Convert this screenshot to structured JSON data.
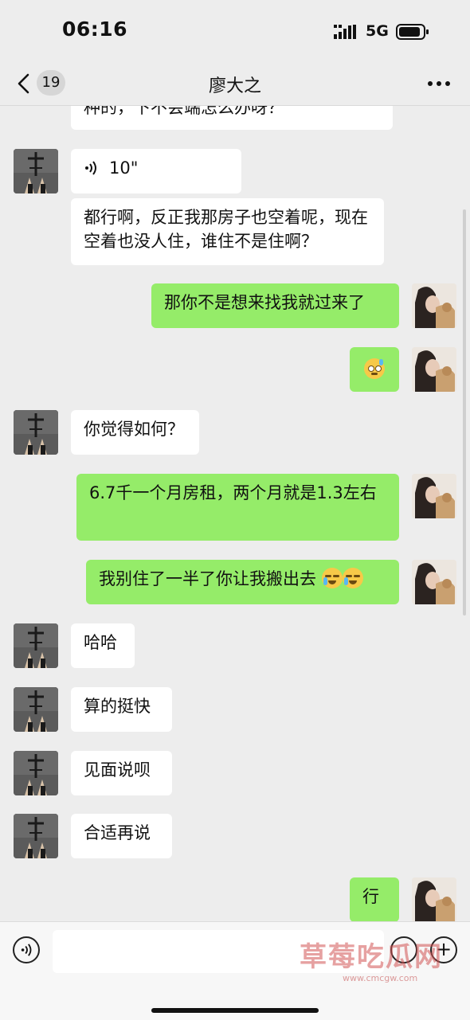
{
  "status_bar": {
    "time": "06:16",
    "network": "5G"
  },
  "header": {
    "back_count": "19",
    "title": "廖大之"
  },
  "messages": [
    {
      "side": "in",
      "type": "text",
      "text": "种的，下不会端怎么办呀？"
    },
    {
      "side": "in",
      "type": "voice",
      "text": "10\""
    },
    {
      "side": "in",
      "type": "text",
      "text": "都行啊，反正我那房子也空着呢，现在空着也没人住，谁住不是住啊？"
    },
    {
      "side": "out",
      "type": "text",
      "text": "那你不是想来找我就过来了"
    },
    {
      "side": "out",
      "type": "emoji",
      "text": ""
    },
    {
      "side": "in",
      "type": "text",
      "text": "你觉得如何？"
    },
    {
      "side": "out",
      "type": "text",
      "text": "6.7千一个月房租，两个月就是1.3左右"
    },
    {
      "side": "out",
      "type": "text",
      "text": "我别住了一半了你让我搬出去"
    },
    {
      "side": "in",
      "type": "text",
      "text": "哈哈"
    },
    {
      "side": "in",
      "type": "text",
      "text": "算的挺快"
    },
    {
      "side": "in",
      "type": "text",
      "text": "见面说呗"
    },
    {
      "side": "in",
      "type": "text",
      "text": "合适再说"
    },
    {
      "side": "out",
      "type": "text",
      "text": "行"
    }
  ],
  "watermark": {
    "title": "草莓吃瓜网",
    "url": "www.cmcgw.com"
  },
  "colors": {
    "incoming_bubble": "#ffffff",
    "outgoing_bubble": "#95ec69",
    "background": "#ededed"
  }
}
